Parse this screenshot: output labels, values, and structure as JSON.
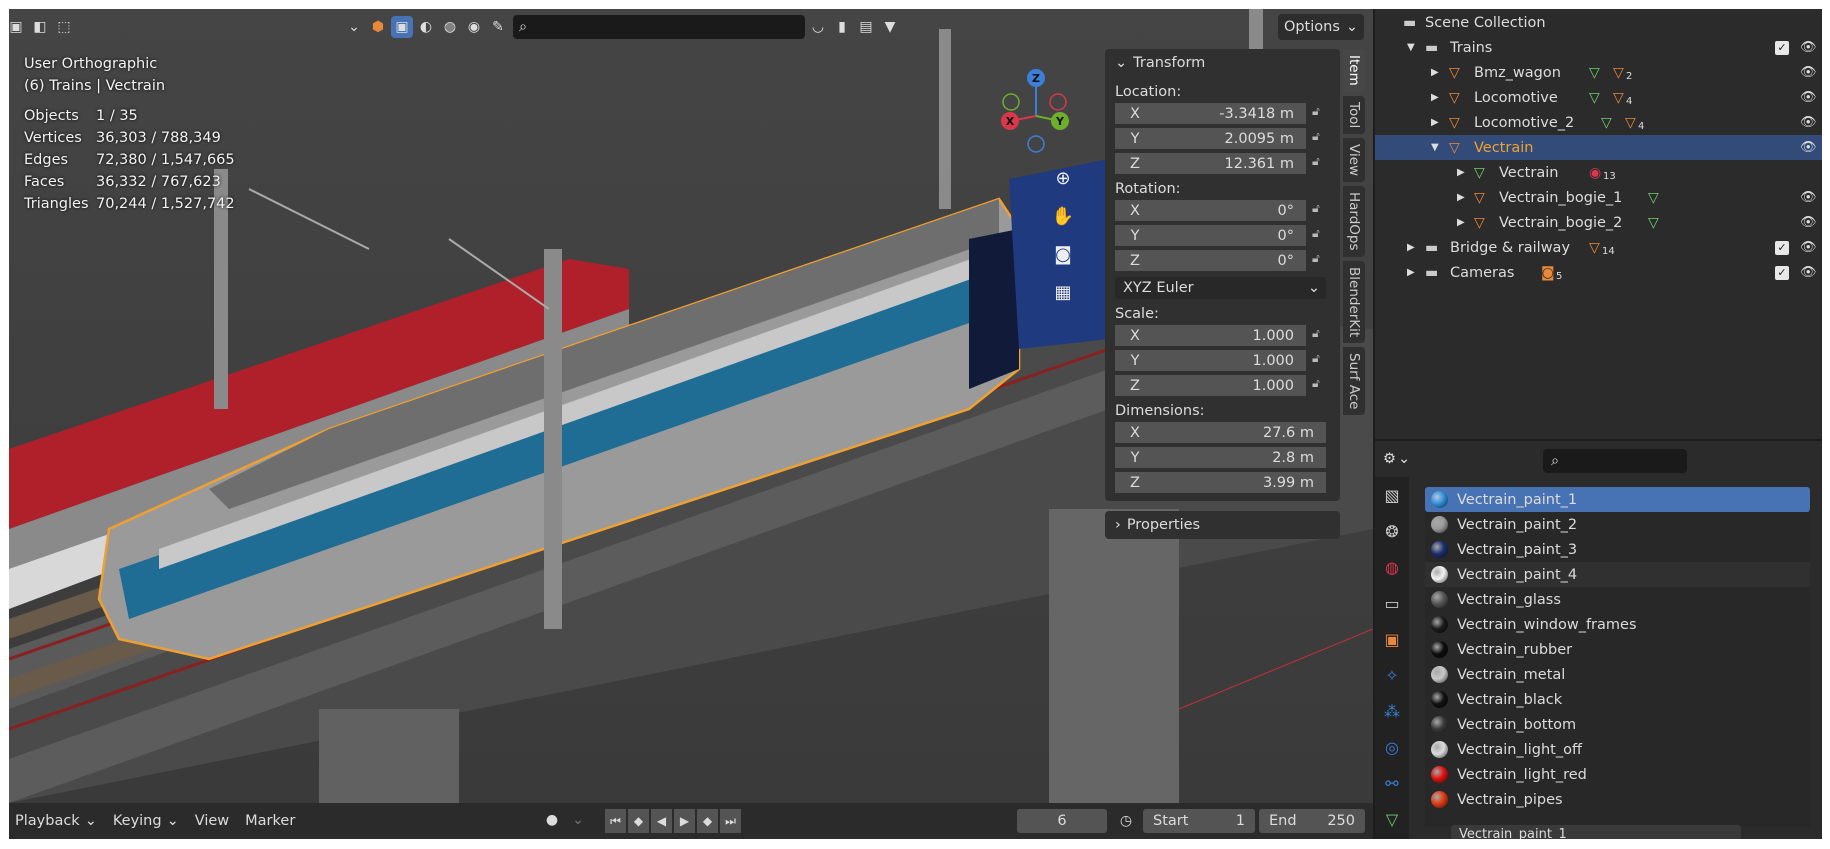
{
  "viewport": {
    "mode_title": "User Orthographic",
    "collection_line": "(6) Trains | Vectrain",
    "stats": [
      {
        "label": "Objects",
        "value": "1 / 35"
      },
      {
        "label": "Vertices",
        "value": "36,303 / 788,349"
      },
      {
        "label": "Edges",
        "value": "72,380 / 1,547,665"
      },
      {
        "label": "Faces",
        "value": "36,332 / 767,623"
      },
      {
        "label": "Triangles",
        "value": "70,244 / 1,527,742"
      }
    ],
    "options_label": "Options",
    "search_placeholder": "",
    "gizmo": {
      "x": "X",
      "y": "Y",
      "z": "Z"
    }
  },
  "transform": {
    "title": "Transform",
    "location_label": "Location:",
    "location": [
      {
        "axis": "X",
        "value": "-3.3418 m"
      },
      {
        "axis": "Y",
        "value": "2.0095 m"
      },
      {
        "axis": "Z",
        "value": "12.361 m"
      }
    ],
    "rotation_label": "Rotation:",
    "rotation": [
      {
        "axis": "X",
        "value": "0°"
      },
      {
        "axis": "Y",
        "value": "0°"
      },
      {
        "axis": "Z",
        "value": "0°"
      }
    ],
    "rotation_mode": "XYZ Euler",
    "scale_label": "Scale:",
    "scale": [
      {
        "axis": "X",
        "value": "1.000"
      },
      {
        "axis": "Y",
        "value": "1.000"
      },
      {
        "axis": "Z",
        "value": "1.000"
      }
    ],
    "dimensions_label": "Dimensions:",
    "dimensions": [
      {
        "axis": "X",
        "value": "27.6 m"
      },
      {
        "axis": "Y",
        "value": "2.8 m"
      },
      {
        "axis": "Z",
        "value": "3.99 m"
      }
    ],
    "properties_label": "Properties"
  },
  "sidebar_tabs": [
    "Item",
    "Tool",
    "View",
    "HardOps",
    "BlenderKit",
    "Surf Ace"
  ],
  "timeline": {
    "menus": [
      "Playback",
      "Keying",
      "View",
      "Marker"
    ],
    "current_frame": "6",
    "start_label": "Start",
    "start": "1",
    "end_label": "End",
    "end": "250"
  },
  "outliner": {
    "root": "Scene Collection",
    "rows": [
      {
        "name": "Trains",
        "badge": ""
      },
      {
        "name": "Bmz_wagon",
        "badge": "2"
      },
      {
        "name": "Locomotive",
        "badge": "4"
      },
      {
        "name": "Locomotive_2",
        "badge": "4"
      },
      {
        "name": "Vectrain",
        "badge": ""
      },
      {
        "name": "Vectrain",
        "badge": "13"
      },
      {
        "name": "Vectrain_bogie_1",
        "badge": ""
      },
      {
        "name": "Vectrain_bogie_2",
        "badge": ""
      },
      {
        "name": "Bridge & railway",
        "badge": "14"
      },
      {
        "name": "Cameras",
        "badge": "5"
      }
    ]
  },
  "materials": {
    "search_placeholder": "",
    "items": [
      {
        "name": "Vectrain_paint_1",
        "color": "#2f8fd8"
      },
      {
        "name": "Vectrain_paint_2",
        "color": "#9a9a9a"
      },
      {
        "name": "Vectrain_paint_3",
        "color": "#1b2f6e"
      },
      {
        "name": "Vectrain_paint_4",
        "color": "#f2f2f2"
      },
      {
        "name": "Vectrain_glass",
        "color": "#555555"
      },
      {
        "name": "Vectrain_window_frames",
        "color": "#1a1a1a"
      },
      {
        "name": "Vectrain_rubber",
        "color": "#0d0d0d"
      },
      {
        "name": "Vectrain_metal",
        "color": "#c8c8c8"
      },
      {
        "name": "Vectrain_black",
        "color": "#111111"
      },
      {
        "name": "Vectrain_bottom",
        "color": "#3a3a3a"
      },
      {
        "name": "Vectrain_light_off",
        "color": "#dcdcdc"
      },
      {
        "name": "Vectrain_light_red",
        "color": "#e01010"
      },
      {
        "name": "Vectrain_pipes",
        "color": "#e03a10"
      }
    ],
    "active_name": "Vectrain_paint_1"
  },
  "colors": {
    "selection": "#4772b3",
    "outline": "#f0a030",
    "accent_orange": "#e8883a"
  }
}
